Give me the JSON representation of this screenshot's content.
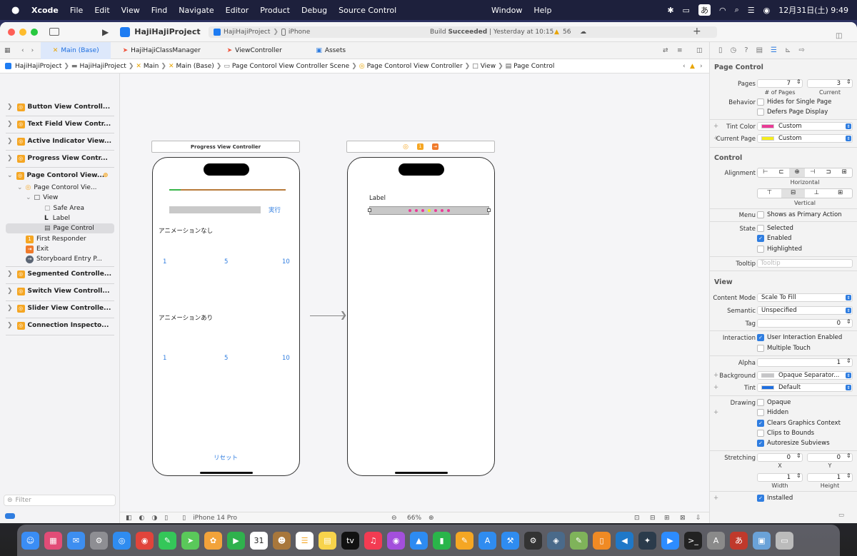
{
  "menubar": {
    "app": "Xcode",
    "items": [
      "File",
      "Edit",
      "View",
      "Find",
      "Navigate",
      "Editor",
      "Product",
      "Debug",
      "Source Control"
    ],
    "center": [
      "Window",
      "Help"
    ],
    "input_mode": "あ",
    "datetime": "12月31日(土)  9:49"
  },
  "toolbar": {
    "project": "HajiHajiProject",
    "scheme": "HajiHajiProject",
    "device": "iPhone",
    "status_prefix": "Build ",
    "status_bold": "Succeeded",
    "status_suffix": " | Yesterday at 10:15",
    "warnings": "56"
  },
  "tabs": [
    "Main (Base)",
    "HajiHajiClassManager",
    "ViewController",
    "Assets"
  ],
  "jumpbar": [
    "HajiHajiProject",
    "HajiHajiProject",
    "Main",
    "Main (Base)",
    "Page Contorol View Controller Scene",
    "Page Contorol View Controller",
    "View",
    "Page Control"
  ],
  "navigator": {
    "groups_top": [
      "Button View Controll...",
      "Text Field View Contr...",
      "Active Indicator View...",
      "Progress View Contr..."
    ],
    "expanded": "Page Contorol View...",
    "children": [
      "Page Contorol Vie...",
      "View",
      "Safe Area",
      "Label",
      "Page Control",
      "First Responder",
      "Exit",
      "Storyboard Entry P..."
    ],
    "groups_bottom": [
      "Segmented Controlle...",
      "Switch View Controll...",
      "Slider View Controlle...",
      "Connection Inspecto..."
    ],
    "filter_placeholder": "Filter"
  },
  "scene1": {
    "title": "Progress View Controller",
    "run": "実行",
    "no_anim": "アニメーションなし",
    "with_anim": "アニメーションあり",
    "t1": "1",
    "t5": "5",
    "t10": "10",
    "reset": "リセット",
    "progress": 0.1
  },
  "scene2": {
    "label": "Label",
    "dots": 7,
    "current": 3
  },
  "bottom": {
    "device": "iPhone 14 Pro",
    "zoom": "66%"
  },
  "inspector": {
    "page_control": "Page Control",
    "pages_label": "Pages",
    "pages": "7",
    "current": "3",
    "of_pages": "# of Pages",
    "current_label": "Current",
    "behavior": "Behavior",
    "hides": "Hides for Single Page",
    "defers": "Defers Page Display",
    "tint_color": "Tint Color",
    "tint_val": "Custom",
    "current_page": "Current Page",
    "current_page_val": "Custom",
    "control": "Control",
    "alignment": "Alignment",
    "horizontal": "Horizontal",
    "vertical": "Vertical",
    "menu": "Menu",
    "primary": "Shows as Primary Action",
    "state": "State",
    "selected": "Selected",
    "enabled": "Enabled",
    "highlighted": "Highlighted",
    "tooltip": "Tooltip",
    "tooltip_ph": "Tooltip",
    "view": "View",
    "content_mode": "Content Mode",
    "content_mode_val": "Scale To Fill",
    "semantic": "Semantic",
    "semantic_val": "Unspecified",
    "tag": "Tag",
    "tag_val": "0",
    "interaction": "Interaction",
    "uie": "User Interaction Enabled",
    "multi": "Multiple Touch",
    "alpha": "Alpha",
    "alpha_val": "1",
    "background": "Background",
    "background_val": "Opaque Separator...",
    "tint": "Tint",
    "tint_default": "Default",
    "drawing": "Drawing",
    "opaque": "Opaque",
    "hidden": "Hidden",
    "clears": "Clears Graphics Context",
    "clips": "Clips to Bounds",
    "autoresize": "Autoresize Subviews",
    "stretching": "Stretching",
    "sx": "0",
    "sy": "0",
    "sw": "1",
    "sh": "1",
    "x": "X",
    "y": "Y",
    "width": "Width",
    "height": "Height",
    "installed": "Installed"
  },
  "colors": {
    "accent": "#2f7de0",
    "pink": "#ea3b96",
    "yellow": "#f5ed1d"
  }
}
